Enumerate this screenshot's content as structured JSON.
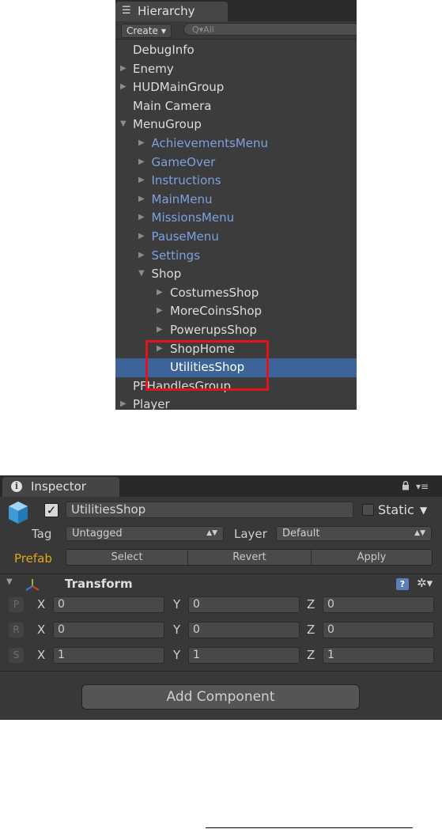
{
  "hierarchy": {
    "tab_icon": "list-icon",
    "tab_label": "Hierarchy",
    "create_label": "Create",
    "search_placeholder": "Q▾All",
    "items": [
      {
        "label": "DebugInfo",
        "arrow": "",
        "prefab": false,
        "selected": false
      },
      {
        "label": "Enemy",
        "arrow": "▶",
        "prefab": false,
        "selected": false
      },
      {
        "label": "HUDMainGroup",
        "arrow": "▶",
        "prefab": false,
        "selected": false
      },
      {
        "label": "Main Camera",
        "arrow": "",
        "prefab": false,
        "selected": false
      },
      {
        "label": "MenuGroup",
        "arrow": "▼",
        "prefab": false,
        "selected": false
      },
      {
        "label": "AchievementsMenu",
        "arrow": "▶",
        "prefab": true,
        "selected": false
      },
      {
        "label": "GameOver",
        "arrow": "▶",
        "prefab": true,
        "selected": false
      },
      {
        "label": "Instructions",
        "arrow": "▶",
        "prefab": true,
        "selected": false
      },
      {
        "label": "MainMenu",
        "arrow": "▶",
        "prefab": true,
        "selected": false
      },
      {
        "label": "MissionsMenu",
        "arrow": "▶",
        "prefab": true,
        "selected": false
      },
      {
        "label": "PauseMenu",
        "arrow": "▶",
        "prefab": true,
        "selected": false
      },
      {
        "label": "Settings",
        "arrow": "▶",
        "prefab": true,
        "selected": false
      },
      {
        "label": "Shop",
        "arrow": "▼",
        "prefab": false,
        "selected": false
      },
      {
        "label": "CostumesShop",
        "arrow": "▶",
        "prefab": false,
        "selected": false
      },
      {
        "label": "MoreCoinsShop",
        "arrow": "▶",
        "prefab": false,
        "selected": false
      },
      {
        "label": "PowerupsShop",
        "arrow": "▶",
        "prefab": false,
        "selected": false
      },
      {
        "label": "ShopHome",
        "arrow": "▶",
        "prefab": false,
        "selected": false
      },
      {
        "label": "UtilitiesShop",
        "arrow": "",
        "prefab": false,
        "selected": true
      },
      {
        "label": "PFHandlesGroup",
        "arrow": "",
        "prefab": false,
        "selected": false
      },
      {
        "label": "Player",
        "arrow": "▶",
        "prefab": false,
        "selected": false
      }
    ],
    "highlight_color": "#e0141d"
  },
  "inspector": {
    "tab_icon": "info-icon",
    "tab_label": "Inspector",
    "object_name": "UtilitiesShop",
    "active_checked": true,
    "static_label": "Static",
    "static_checked": false,
    "tag_label": "Tag",
    "tag_value": "Untagged",
    "layer_label": "Layer",
    "layer_value": "Default",
    "prefab_label": "Prefab",
    "prefab_buttons": [
      "Select",
      "Revert",
      "Apply"
    ],
    "transform_title": "Transform",
    "transform_rows": [
      {
        "btn": "P",
        "x": "0",
        "y": "0",
        "z": "0"
      },
      {
        "btn": "R",
        "x": "0",
        "y": "0",
        "z": "0"
      },
      {
        "btn": "S",
        "x": "1",
        "y": "1",
        "z": "1"
      }
    ],
    "axis_labels": [
      "X",
      "Y",
      "Z"
    ],
    "add_component_label": "Add Component"
  },
  "colors": {
    "panel_bg": "#3c3c3c",
    "selection": "#3d6499",
    "prefab_text": "#7da0e0",
    "prefab_label": "#e5a711"
  }
}
